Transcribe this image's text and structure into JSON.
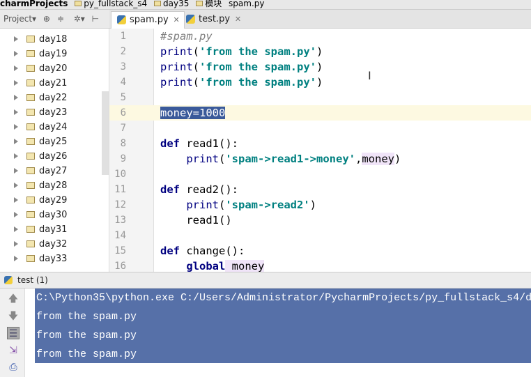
{
  "breadcrumb": [
    "charmProjects",
    "py_fullstack_s4",
    "day35",
    "模块",
    "spam.py"
  ],
  "toolbar": {
    "project_label": "Project▾",
    "icons": [
      "target-icon",
      "collapse-icon",
      "gear-icon",
      "pin-icon"
    ]
  },
  "tabs": [
    {
      "label": "spam.py",
      "active": true
    },
    {
      "label": "test.py",
      "active": false
    }
  ],
  "sidebar": {
    "items": [
      "day18",
      "day19",
      "day20",
      "day21",
      "day22",
      "day23",
      "day24",
      "day25",
      "day26",
      "day27",
      "day28",
      "day29",
      "day30",
      "day31",
      "day32",
      "day33"
    ]
  },
  "editor": {
    "line_numbers": [
      "1",
      "2",
      "3",
      "4",
      "5",
      "6",
      "7",
      "8",
      "9",
      "10",
      "11",
      "12",
      "13",
      "14",
      "15",
      "16"
    ],
    "lines": {
      "l1": "#spam.py",
      "print": "print",
      "str_from": "'from the spam.py'",
      "l6": "money=1000",
      "def": "def",
      "read1": " read1():",
      "str_r1": "'spam->read1->money'",
      "money": "money",
      "read2": " read2():",
      "str_r2": "'spam->read2'",
      "call_read1": "read1()",
      "change": " change():",
      "global": "global",
      "gmoney": " money"
    }
  },
  "run": {
    "tab_label": "test (1)",
    "console": [
      "C:\\Python35\\python.exe C:/Users/Administrator/PycharmProjects/py_fullstack_s4/d",
      "from the spam.py",
      "from the spam.py",
      "from the spam.py"
    ]
  }
}
